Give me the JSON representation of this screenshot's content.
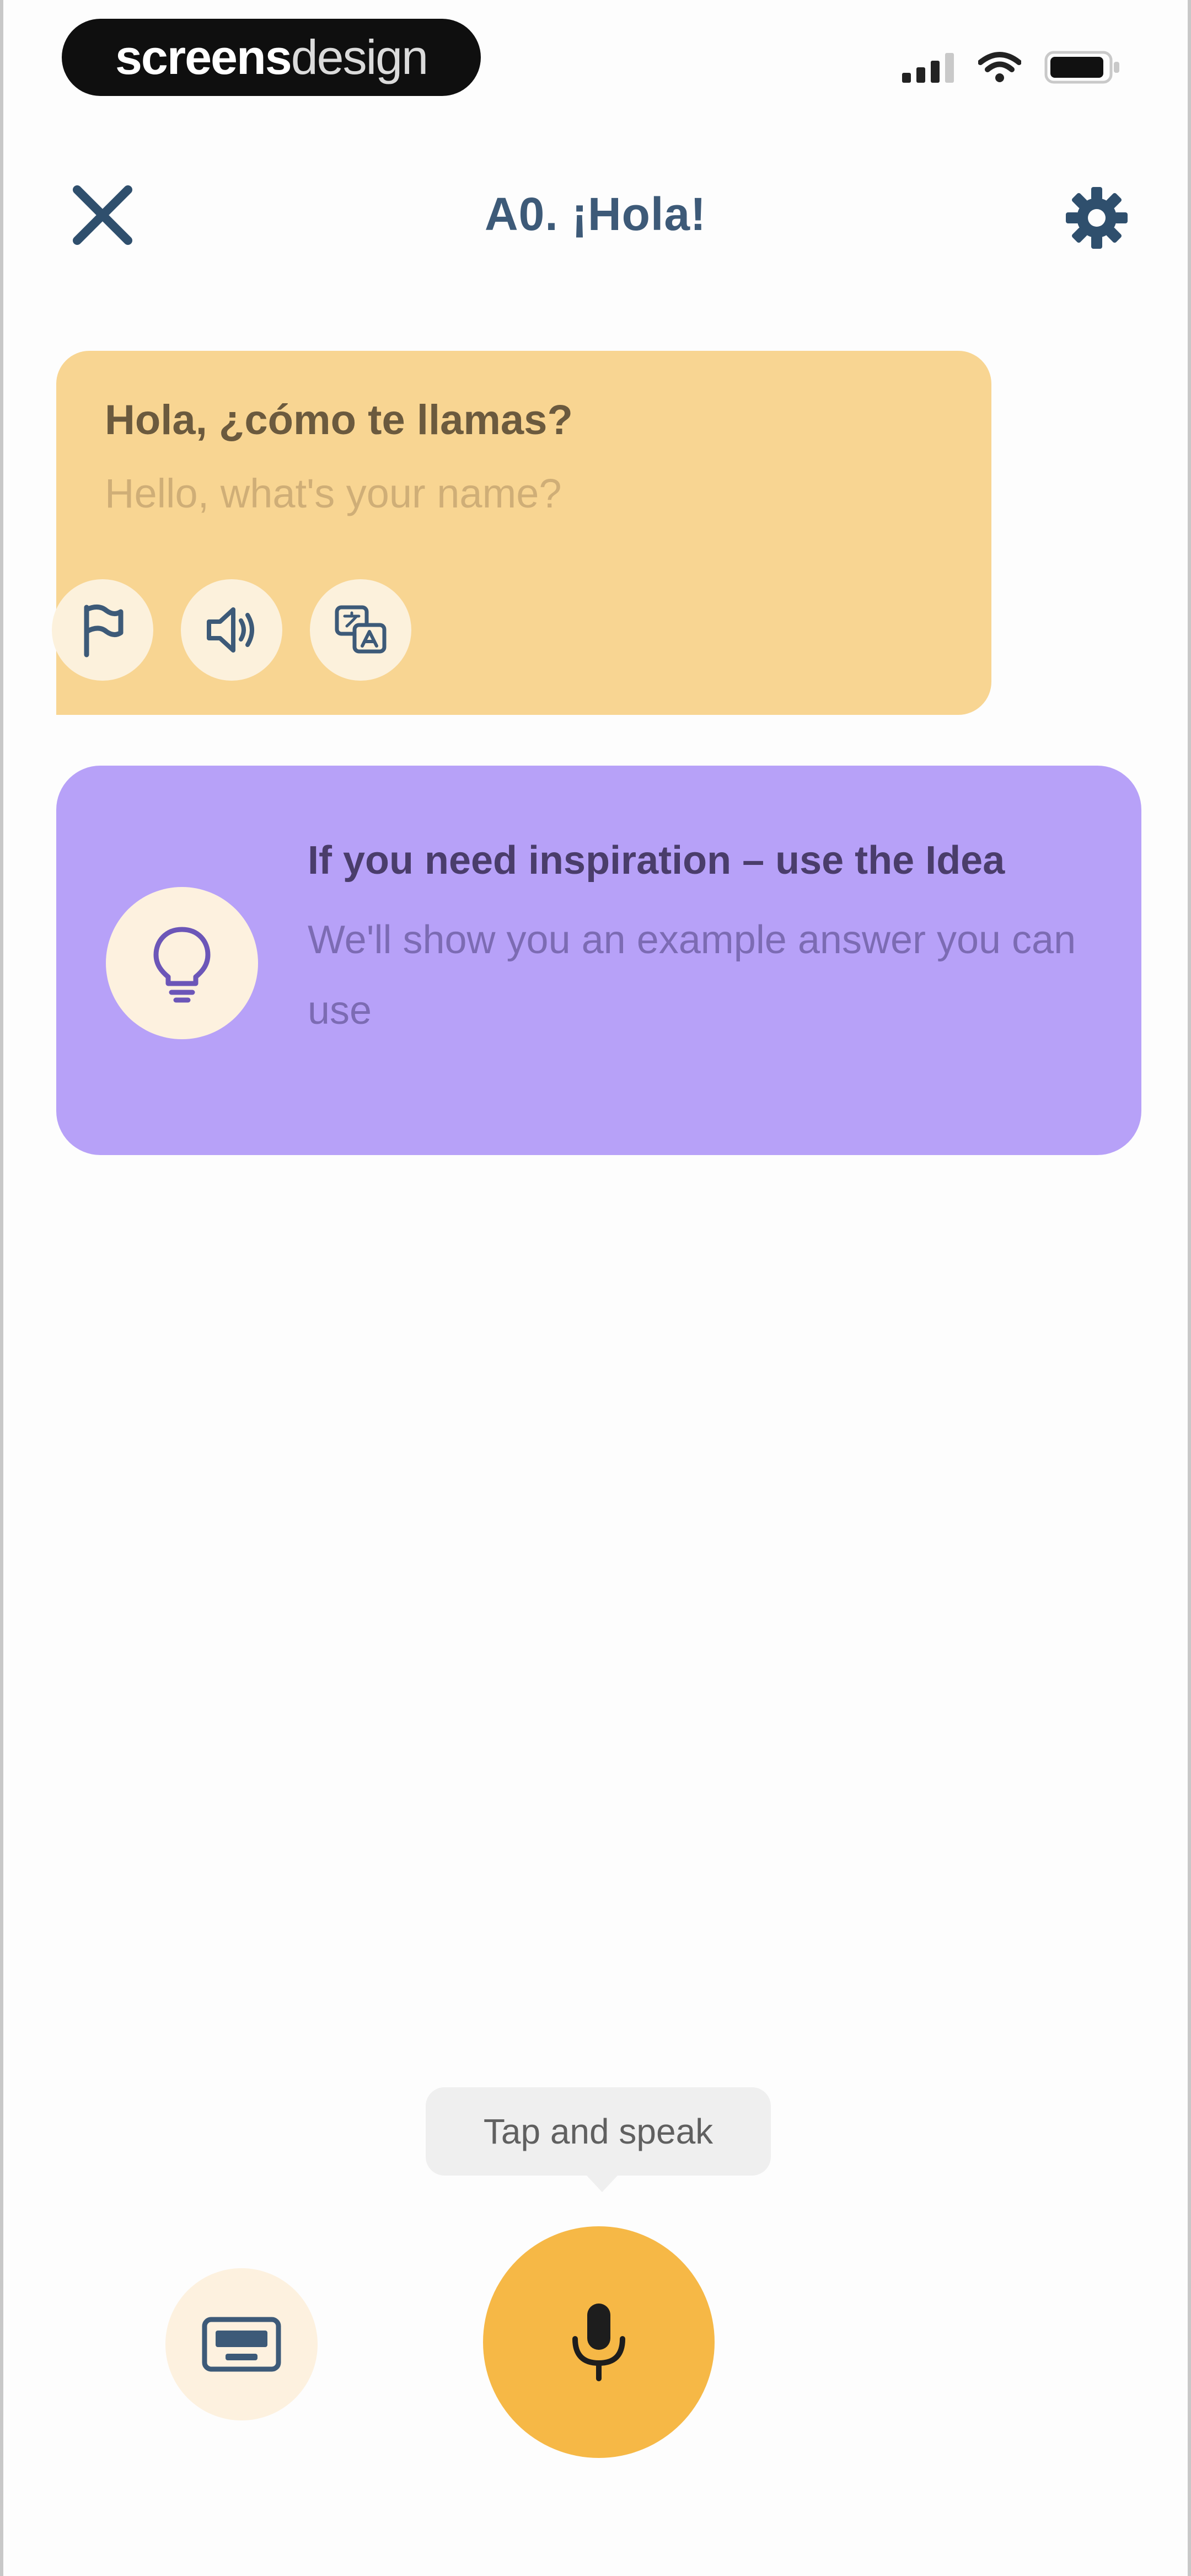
{
  "status_bar": {
    "brand_bold": "screens",
    "brand_light": "design"
  },
  "header": {
    "title": "A0. ¡Hola!"
  },
  "message": {
    "text": "Hola, ¿cómo te llamas?",
    "translation": "Hello, what's your name?"
  },
  "hint": {
    "title": "If you need inspiration – use the Idea",
    "subtitle": "We'll show you an example answer you can use"
  },
  "bottom": {
    "tooltip": "Tap and speak"
  },
  "colors": {
    "accent": "#f6b846",
    "bubble": "#f8d592",
    "hint_card": "#b7a1f8",
    "header_text": "#3d5a78"
  },
  "icons": {
    "close": "close-icon",
    "settings": "gear-icon",
    "flag": "flag-icon",
    "speaker": "speaker-icon",
    "translate": "translate-icon",
    "idea": "lightbulb-icon",
    "keyboard": "keyboard-icon",
    "mic": "microphone-icon"
  }
}
